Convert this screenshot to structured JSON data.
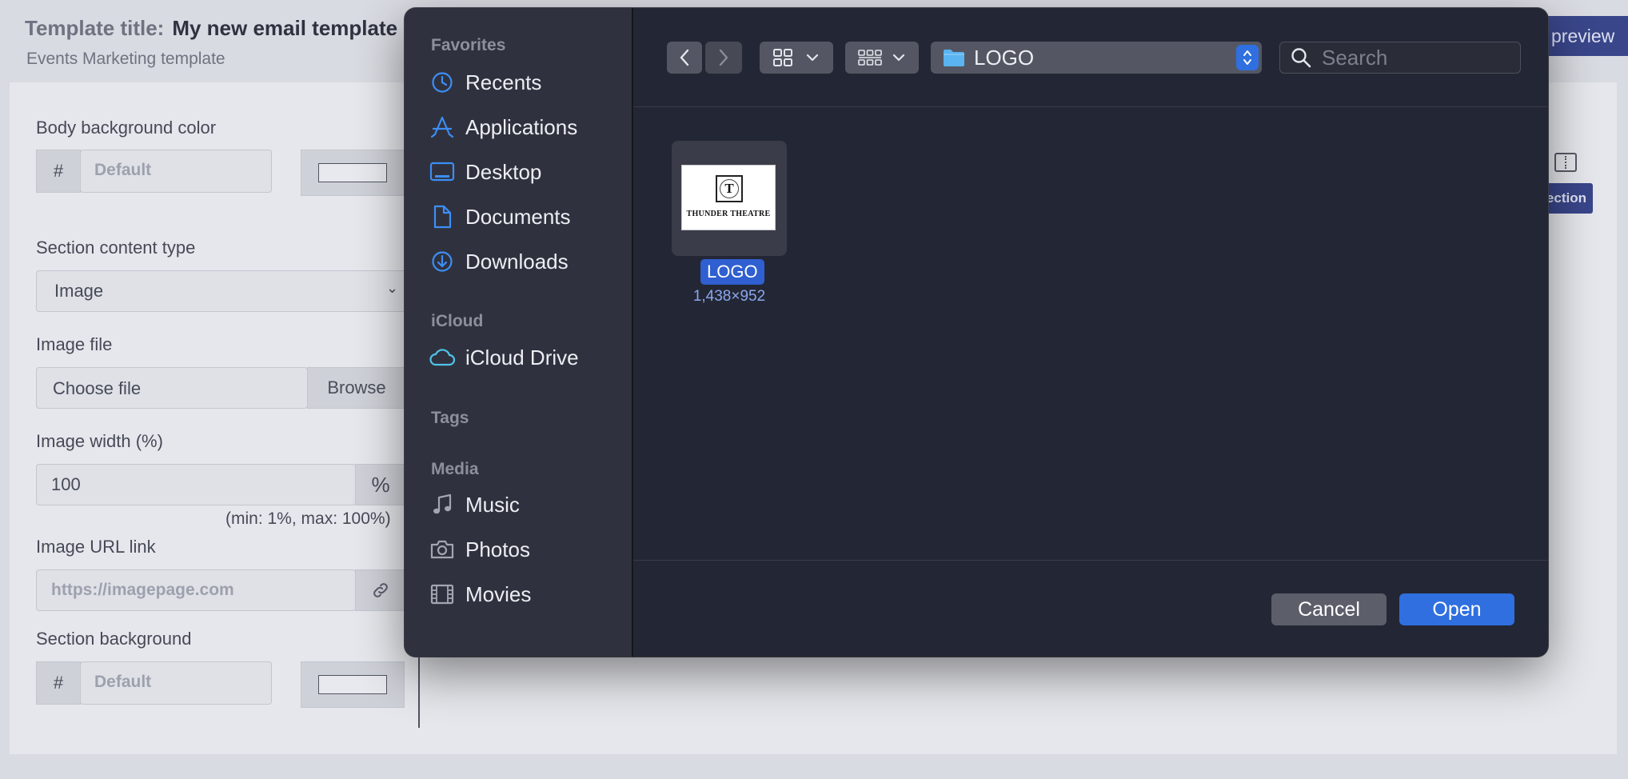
{
  "background_page": {
    "template_title_label": "Template title:",
    "template_title_value": "My new email template",
    "template_subtitle": "Events Marketing template",
    "preview_button": "preview",
    "section_button": "section",
    "fields": {
      "body_bg_label": "Body background color",
      "body_bg_prefix": "#",
      "body_bg_placeholder": "Default",
      "section_content_type_label": "Section content type",
      "section_content_type_value": "Image",
      "image_file_label": "Image file",
      "image_file_placeholder": "Choose file",
      "image_file_browse": "Browse",
      "image_width_label": "Image width (%)",
      "image_width_value": "100",
      "image_width_suffix": "%",
      "image_width_hint": "(min: 1%, max: 100%)",
      "image_url_label": "Image URL link",
      "image_url_placeholder": "https://imagepage.com",
      "section_bg_label": "Section background",
      "section_bg_prefix": "#",
      "section_bg_placeholder": "Default"
    }
  },
  "dialog": {
    "sidebar": {
      "favorites_heading": "Favorites",
      "favorites": [
        {
          "label": "Recents",
          "icon": "clock-icon"
        },
        {
          "label": "Applications",
          "icon": "applications-icon"
        },
        {
          "label": "Desktop",
          "icon": "desktop-icon"
        },
        {
          "label": "Documents",
          "icon": "document-icon"
        },
        {
          "label": "Downloads",
          "icon": "download-icon"
        }
      ],
      "icloud_heading": "iCloud",
      "icloud": [
        {
          "label": "iCloud Drive",
          "icon": "cloud-icon"
        }
      ],
      "tags_heading": "Tags",
      "media_heading": "Media",
      "media": [
        {
          "label": "Music",
          "icon": "music-icon"
        },
        {
          "label": "Photos",
          "icon": "camera-icon"
        },
        {
          "label": "Movies",
          "icon": "film-icon"
        }
      ]
    },
    "toolbar": {
      "current_folder": "LOGO",
      "search_placeholder": "Search"
    },
    "files": [
      {
        "name": "LOGO",
        "dimensions": "1,438×952",
        "thumbnail_text": "THUNDER THEATRE",
        "thumbnail_emblem": "T"
      }
    ],
    "buttons": {
      "cancel": "Cancel",
      "open": "Open"
    }
  },
  "colors": {
    "accent_blue": "#2f6fe0",
    "dialog_bg": "#232634",
    "sidebar_bg": "#2f323e",
    "selection_blue": "#2f5fd0",
    "sidebar_icon_blue": "#3d8ef5",
    "icloud_icon": "#4fc3e8"
  }
}
